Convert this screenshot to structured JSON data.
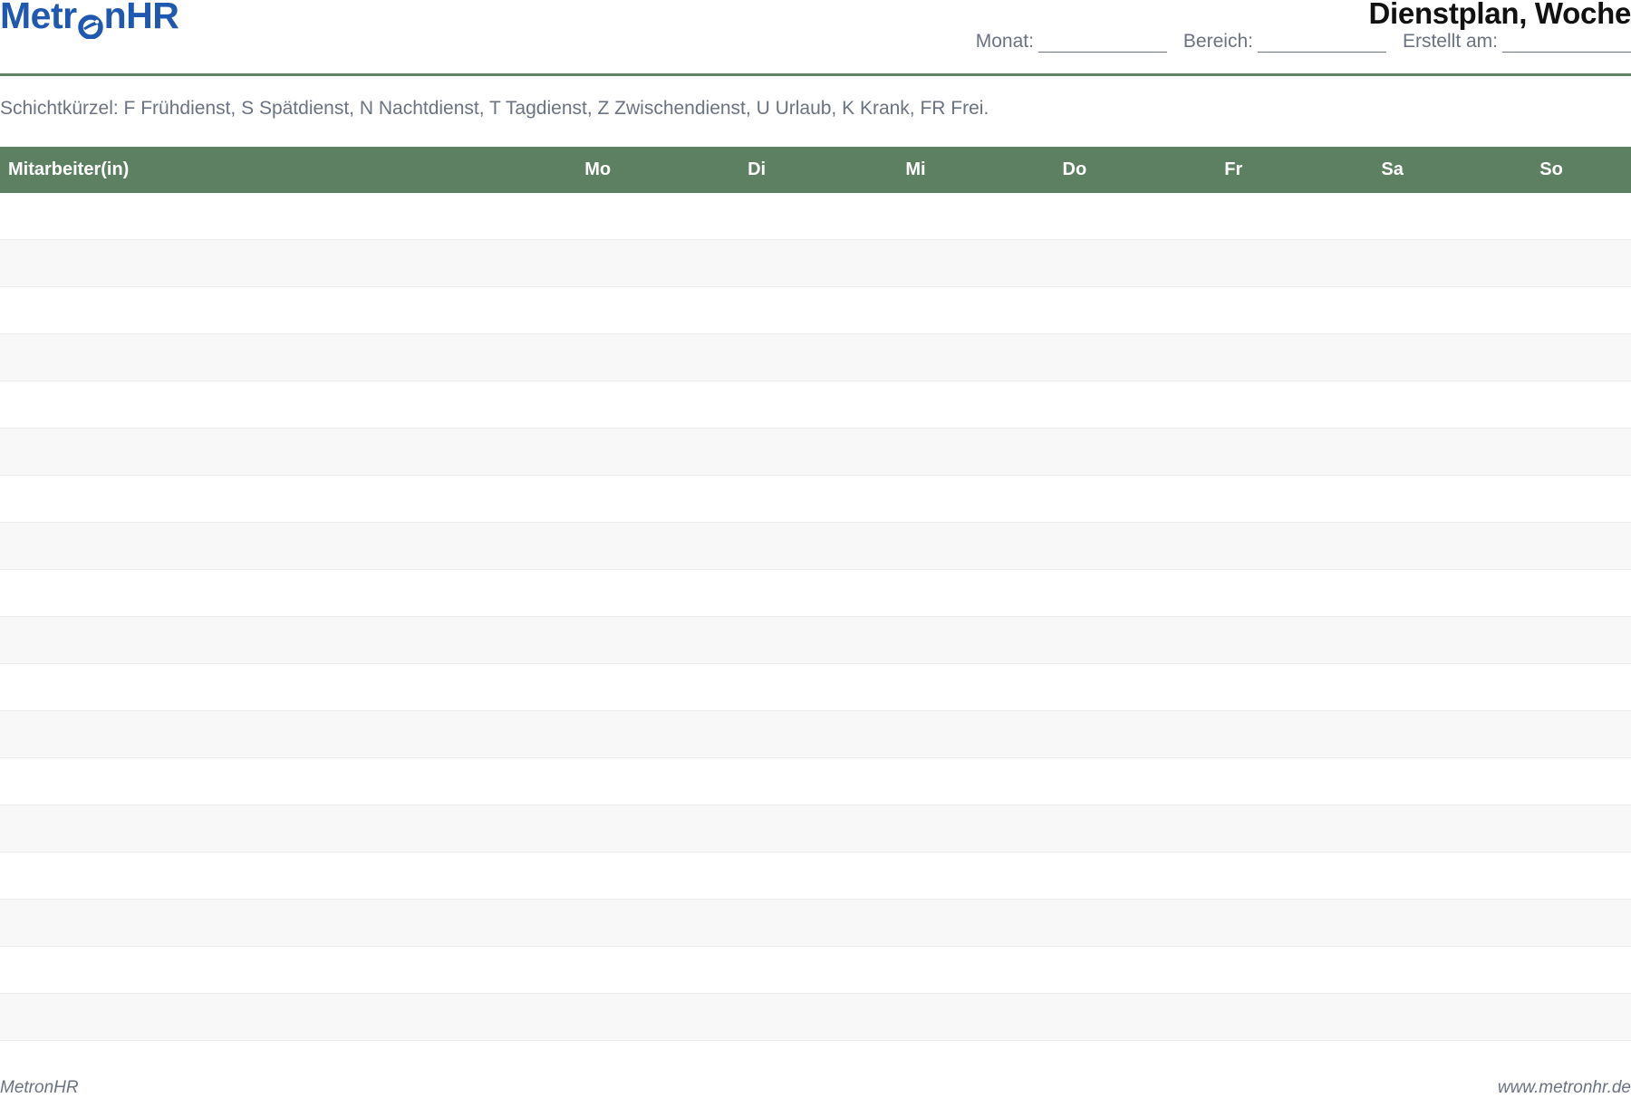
{
  "header": {
    "logo_text_before": "Metr",
    "logo_text_after": "nHR",
    "title": "Dienstplan, Woche",
    "fields": {
      "month_label": "Monat:",
      "area_label": "Bereich:",
      "created_label": "Erstellt am:"
    }
  },
  "legend": "Schichtkürzel: F Frühdienst, S Spätdienst, N Nachtdienst, T Tagdienst, Z Zwischendienst, U Urlaub, K Krank, FR Frei.",
  "table": {
    "columns": [
      "Mitarbeiter(in)",
      "Mo",
      "Di",
      "Mi",
      "Do",
      "Fr",
      "Sa",
      "So"
    ],
    "row_count": 18
  },
  "footer": {
    "left": "MetronHR",
    "right": "www.metronhr.de"
  },
  "colors": {
    "brand": "#1f58b0",
    "header_green": "#5e8062",
    "text_gray": "#6b7280"
  }
}
